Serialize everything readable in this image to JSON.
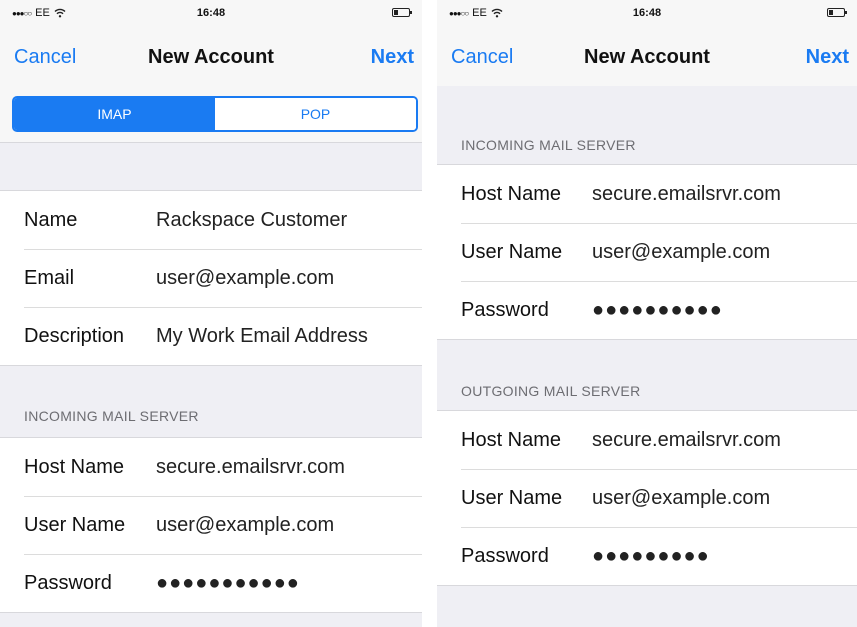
{
  "status_bar": {
    "signal": "●●●○○",
    "carrier": "EE",
    "time": "16:48"
  },
  "nav": {
    "cancel_label": "Cancel",
    "title": "New Account",
    "next_label": "Next"
  },
  "segments": {
    "imap_label": "IMAP",
    "pop_label": "POP",
    "selected": "IMAP"
  },
  "account_info": {
    "name_label": "Name",
    "name_value": "Rackspace Customer",
    "email_label": "Email",
    "email_value": "user@example.com",
    "description_label": "Description",
    "description_value": "My Work Email Address"
  },
  "incoming": {
    "header": "INCOMING MAIL SERVER",
    "host_label": "Host Name",
    "host_value": "secure.emailsrvr.com",
    "user_label": "User Name",
    "user_value": "user@example.com",
    "password_label": "Password",
    "password_value_left": "●●●●●●●●●●●",
    "password_value_right": "●●●●●●●●●●"
  },
  "outgoing": {
    "header": "OUTGOING MAIL SERVER",
    "host_label": "Host Name",
    "host_value": "secure.emailsrvr.com",
    "user_label": "User Name",
    "user_value": "user@example.com",
    "password_label": "Password",
    "password_value": "●●●●●●●●●"
  },
  "colors": {
    "accent": "#1a7bf2",
    "grouped_background": "#efeff4",
    "section_header": "#6d6d72"
  }
}
